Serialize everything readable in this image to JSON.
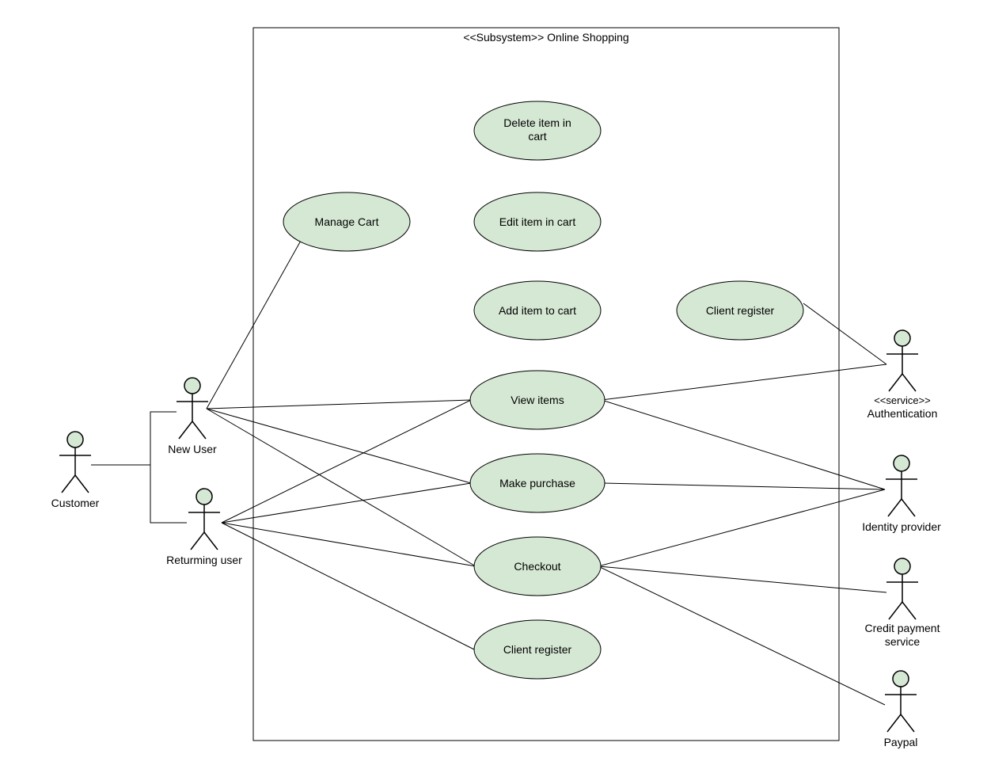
{
  "system": {
    "title": "<<Subsystem>> Online Shopping"
  },
  "actors": {
    "customer": "Customer",
    "new_user": "New User",
    "returning_user": "Returming user",
    "authentication_stereo": "<<service>>",
    "authentication": "Authentication",
    "identity_provider": "Identity provider",
    "credit_payment_1": "Credit payment",
    "credit_payment_2": "service",
    "paypal": "Paypal"
  },
  "usecases": {
    "manage_cart": "Manage Cart",
    "delete_item_1": "Delete item in",
    "delete_item_2": "cart",
    "edit_item": "Edit item in cart",
    "add_item": "Add item to cart",
    "client_register_top": "Client register",
    "view_items": "View items",
    "make_purchase": "Make purchase",
    "checkout": "Checkout",
    "client_register_bottom": "Client register"
  }
}
